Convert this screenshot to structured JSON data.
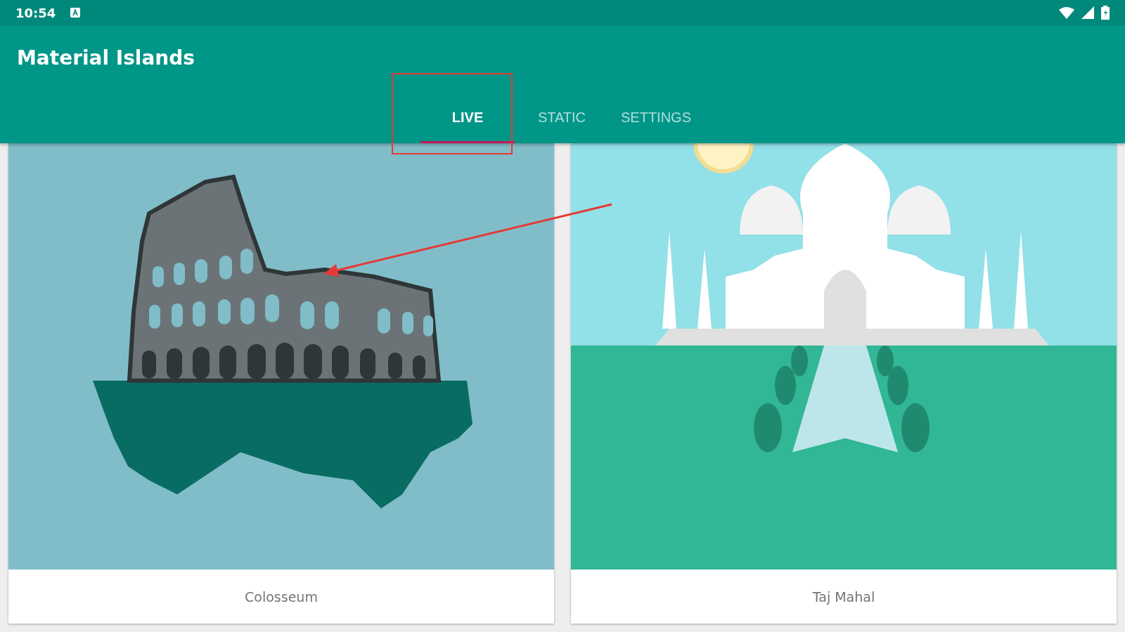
{
  "status_bar": {
    "time": "10:54"
  },
  "app_bar": {
    "title": "Material Islands"
  },
  "tabs": [
    {
      "label": "LIVE",
      "selected": true
    },
    {
      "label": "STATIC",
      "selected": false
    },
    {
      "label": "SETTINGS",
      "selected": false
    }
  ],
  "cards": [
    {
      "kind": "colosseum",
      "caption": "Colosseum"
    },
    {
      "kind": "taj-mahal",
      "caption": "Taj Mahal"
    }
  ]
}
